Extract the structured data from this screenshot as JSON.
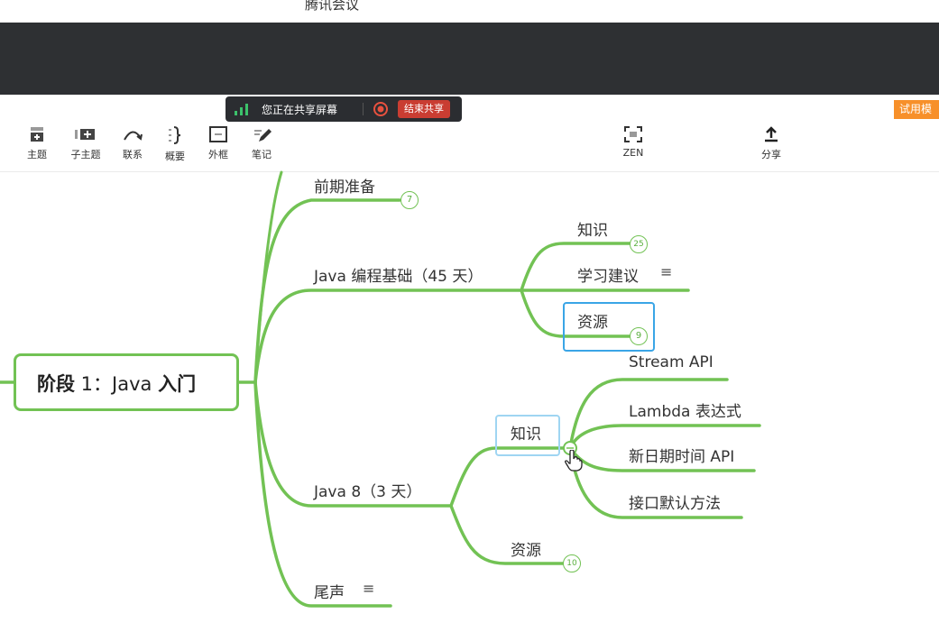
{
  "window": {
    "title": "腾讯会议"
  },
  "share_bar": {
    "message": "您正在共享屏幕",
    "end_label": "结束共享"
  },
  "trial_badge": "试用模",
  "toolbar": {
    "items": [
      {
        "label": "主题",
        "icon": "topic-icon"
      },
      {
        "label": "子主题",
        "icon": "subtopic-icon"
      },
      {
        "label": "联系",
        "icon": "relationship-icon"
      },
      {
        "label": "概要",
        "icon": "summary-brace-icon"
      },
      {
        "label": "外框",
        "icon": "boundary-icon"
      },
      {
        "label": "笔记",
        "icon": "note-pen-icon"
      }
    ],
    "zen_label": "ZEN",
    "share_label": "分享"
  },
  "colors": {
    "branch": "#72c254",
    "selection": "#3aa5e6",
    "dark_band": "#2e3033",
    "end_button": "#c93d32",
    "trial": "#f7902a"
  },
  "mindmap": {
    "root": {
      "label_bold": "阶段",
      "label_light": " 1：Java ",
      "label_bold2": "入门"
    },
    "branches": [
      {
        "label": "前期准备",
        "badge": "7"
      },
      {
        "label": "Java 编程基础（45 天）",
        "children": [
          {
            "label": "知识",
            "badge": "25"
          },
          {
            "label": "学习建议",
            "note": "≡"
          },
          {
            "label": "资源",
            "badge": "9"
          }
        ]
      },
      {
        "label": "Java 8（3 天）",
        "children": [
          {
            "label": "知识",
            "children": [
              "Stream API",
              "Lambda 表达式",
              "新日期时间 API",
              "接口默认方法"
            ]
          },
          {
            "label": "资源",
            "badge": "10"
          }
        ]
      },
      {
        "label": "尾声",
        "note": "≡"
      }
    ]
  }
}
